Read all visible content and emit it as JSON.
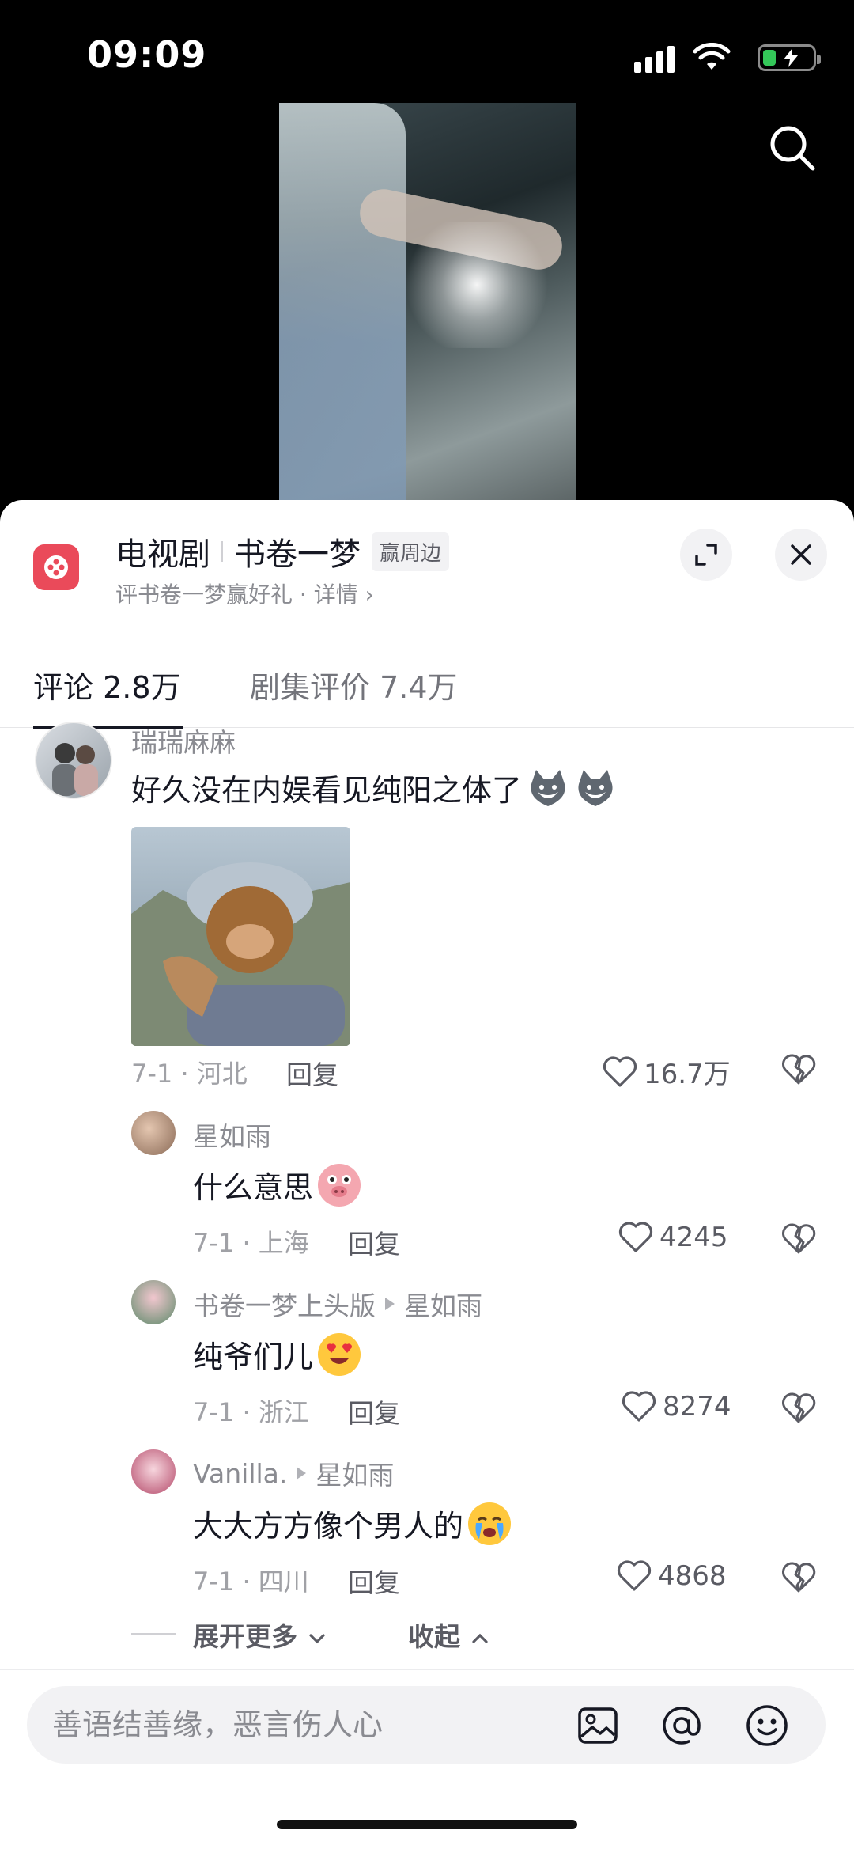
{
  "status_bar": {
    "time": "09:09"
  },
  "drama": {
    "category": "电视剧",
    "title": "书卷一梦",
    "badge": "赢周边",
    "subtitle": "评书卷一梦赢好礼 · 详情 ›"
  },
  "tabs": [
    {
      "label": "评论 2.8万",
      "active": true
    },
    {
      "label": "剧集评价 7.4万",
      "active": false
    }
  ],
  "comments": [
    {
      "username": "瑞瑞麻麻",
      "text": "好久没在内娱看见纯阳之体了",
      "emojis": [
        "wolf-emoji",
        "wolf-emoji"
      ],
      "meta": "7-1 · 河北",
      "reply_label": "回复",
      "likes": "16.7万",
      "has_image": true
    }
  ],
  "replies": [
    {
      "username": "星如雨",
      "reply_to": "",
      "text": "什么意思",
      "emoji": "pig-emoji",
      "meta": "7-1 · 上海",
      "reply_label": "回复",
      "likes": "4245"
    },
    {
      "username": "书卷一梦上头版",
      "reply_to": "星如雨",
      "text": "纯爷们儿",
      "emoji": "heart-eyes-emoji",
      "meta": "7-1 · 浙江",
      "reply_label": "回复",
      "likes": "8274"
    },
    {
      "username": "Vanilla.",
      "reply_to": "星如雨",
      "text": "大大方方像个男人的",
      "emoji": "crying-emoji",
      "meta": "7-1 · 四川",
      "reply_label": "回复",
      "likes": "4868"
    }
  ],
  "expand": {
    "more": "展开更多",
    "collapse": "收起"
  },
  "input": {
    "placeholder": "善语结善缘，恶言伤人心"
  },
  "icons": {
    "search": "search-icon",
    "expand": "expand-icon",
    "close": "close-icon",
    "image": "image-icon",
    "mention": "at-icon",
    "emoji": "emoji-icon",
    "like": "heart-icon",
    "dislike": "broken-heart-icon"
  },
  "colors": {
    "accent": "#ea4a5a",
    "text": "#161823",
    "muted": "#8a8b91",
    "battery": "#34c759"
  }
}
